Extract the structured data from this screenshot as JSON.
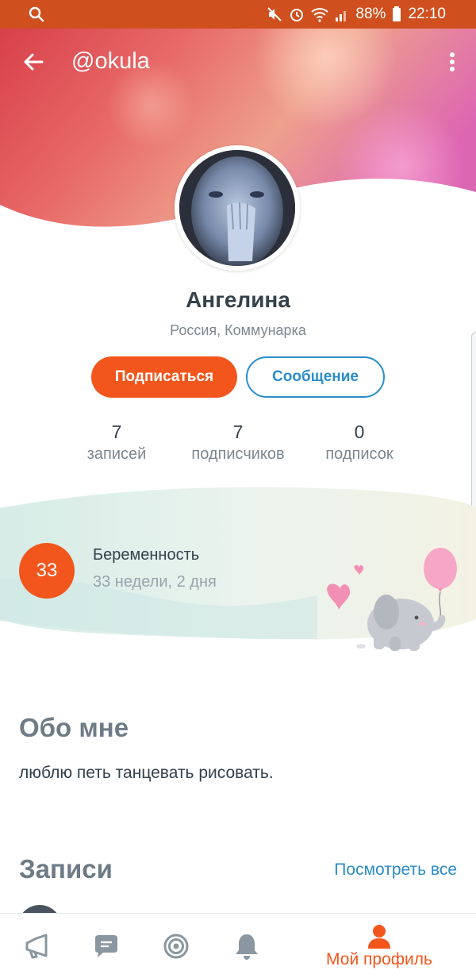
{
  "status_bar": {
    "battery": "88%",
    "time": "22:10"
  },
  "header": {
    "username": "@okula"
  },
  "profile": {
    "name": "Ангелина",
    "location": "Россия, Коммунарка",
    "subscribe_label": "Подписаться",
    "message_label": "Сообщение",
    "stats": [
      {
        "value": "7",
        "label": "записей"
      },
      {
        "value": "7",
        "label": "подписчиков"
      },
      {
        "value": "0",
        "label": "подписок"
      }
    ]
  },
  "pregnancy": {
    "badge": "33",
    "title": "Беременность",
    "subtitle": "33 недели, 2 дня"
  },
  "about": {
    "title": "Обо мне",
    "text": "люблю петь танцевать рисовать."
  },
  "posts": {
    "title": "Записи",
    "see_all": "Посмотреть все"
  },
  "bottom_nav": {
    "active_label": "Мой профиль",
    "items": [
      "megaphone-icon",
      "chat-icon",
      "target-icon",
      "bell-icon",
      "person-icon"
    ]
  },
  "colors": {
    "accent": "#f2561d",
    "link": "#2a8dca",
    "status_bar": "#cf4f1e"
  }
}
